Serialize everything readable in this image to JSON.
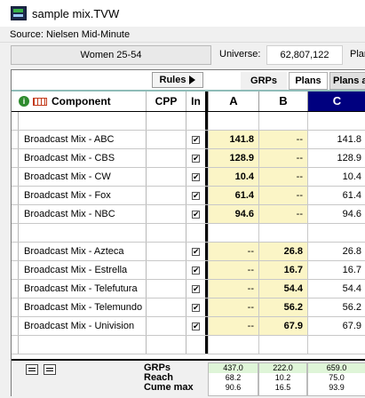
{
  "window": {
    "title": "sample mix.TVW"
  },
  "source": "Source: Nielsen Mid-Minute",
  "infobar": {
    "demo": "Women 25-54",
    "universe_label": "Universe:",
    "universe_value": "62,807,122",
    "plan_label": "Plar"
  },
  "toolbar": {
    "rules_label": "Rules",
    "tabs": [
      "GRPs",
      "Plans",
      "Plans a"
    ]
  },
  "header": {
    "component": "Component",
    "cpp": "CPP",
    "in": "In",
    "cols": [
      "A",
      "B",
      "C"
    ]
  },
  "rows": [
    {
      "label": "",
      "check": "",
      "a": "",
      "b": "",
      "c": ""
    },
    {
      "label": "Broadcast Mix - ABC",
      "check": "✔",
      "a": "141.8",
      "b": "--",
      "c": "141.8"
    },
    {
      "label": "Broadcast Mix - CBS",
      "check": "✔",
      "a": "128.9",
      "b": "--",
      "c": "128.9"
    },
    {
      "label": "Broadcast Mix - CW",
      "check": "✔",
      "a": "10.4",
      "b": "--",
      "c": "10.4"
    },
    {
      "label": "Broadcast Mix - Fox",
      "check": "✔",
      "a": "61.4",
      "b": "--",
      "c": "61.4"
    },
    {
      "label": "Broadcast Mix - NBC",
      "check": "✔",
      "a": "94.6",
      "b": "--",
      "c": "94.6"
    },
    {
      "label": "",
      "check": "",
      "a": "",
      "b": "",
      "c": ""
    },
    {
      "label": "Broadcast Mix - Azteca",
      "check": "✔",
      "a": "--",
      "b": "26.8",
      "c": "26.8"
    },
    {
      "label": "Broadcast Mix - Estrella",
      "check": "✔",
      "a": "--",
      "b": "16.7",
      "c": "16.7"
    },
    {
      "label": "Broadcast Mix - Telefutura",
      "check": "✔",
      "a": "--",
      "b": "54.4",
      "c": "54.4"
    },
    {
      "label": "Broadcast Mix - Telemundo",
      "check": "✔",
      "a": "--",
      "b": "56.2",
      "c": "56.2"
    },
    {
      "label": "Broadcast Mix - Univision",
      "check": "✔",
      "a": "--",
      "b": "67.9",
      "c": "67.9"
    },
    {
      "label": "",
      "check": "",
      "a": "",
      "b": "",
      "c": ""
    }
  ],
  "footer": {
    "labels": [
      "GRPs",
      "Reach",
      "Cume max"
    ],
    "a": [
      "437.0",
      "68.2",
      "90.6"
    ],
    "b": [
      "222.0",
      "10.2",
      "16.5"
    ],
    "c": [
      "659.0",
      "75.0",
      "93.9"
    ]
  }
}
